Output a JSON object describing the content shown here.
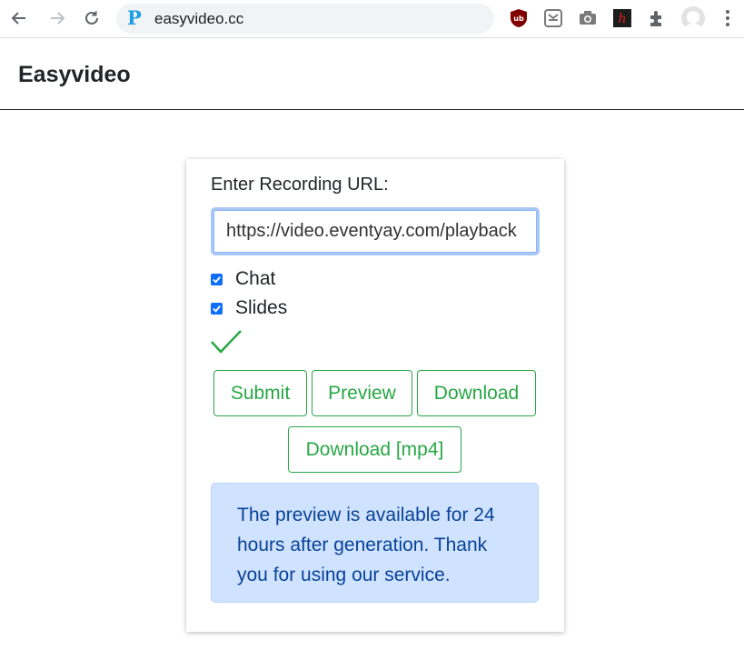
{
  "browser": {
    "url": "easyvideo.cc",
    "site_icon_letter": "P",
    "icons": [
      "back-icon",
      "forward-icon",
      "reload-icon",
      "ublock-icon",
      "shield-extension-icon",
      "camera-extension-icon",
      "h-extension-icon",
      "extensions-puzzle-icon",
      "profile-avatar-icon",
      "menu-dots-icon"
    ]
  },
  "header": {
    "brand": "Easyvideo"
  },
  "form": {
    "label": "Enter Recording URL:",
    "url_value": "https://video.eventyay.com/playback",
    "options": [
      {
        "label": "Chat",
        "checked": true
      },
      {
        "label": "Slides",
        "checked": true
      }
    ],
    "status_icon": "checkmark-success-icon",
    "buttons": {
      "submit": "Submit",
      "preview": "Preview",
      "download": "Download",
      "download_mp4": "Download [mp4]"
    },
    "notice": "The preview is available for 24 hours after generation. Thank you for using our service."
  },
  "colors": {
    "success": "#28a745",
    "primary": "#0d6efd",
    "info_bg": "#cfe2ff",
    "info_text": "#084298"
  }
}
